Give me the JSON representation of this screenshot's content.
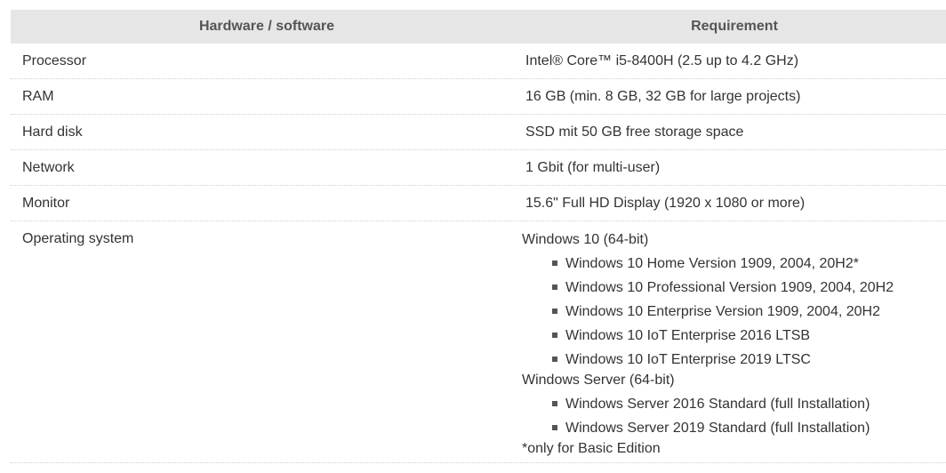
{
  "table": {
    "headers": {
      "hardware_software": "Hardware / software",
      "requirement": "Requirement"
    },
    "rows": [
      {
        "label": "Processor",
        "value": "Intel® Core™ i5-8400H (2.5 up to 4.2 GHz)"
      },
      {
        "label": "RAM",
        "value": "16 GB (min. 8 GB, 32 GB for large projects)"
      },
      {
        "label": "Hard disk",
        "value": "SSD mit 50 GB free storage space"
      },
      {
        "label": "Network",
        "value": "1 Gbit (for multi-user)"
      },
      {
        "label": "Monitor",
        "value": "15.6\" Full HD Display (1920 x 1080 or more)"
      }
    ],
    "os": {
      "label": "Operating system",
      "windows10": {
        "title": "Windows 10 (64-bit)",
        "items": [
          "Windows 10 Home Version 1909, 2004, 20H2*",
          "Windows 10 Professional Version 1909, 2004, 20H2",
          "Windows 10 Enterprise Version 1909, 2004, 20H2",
          "Windows 10 IoT Enterprise 2016 LTSB",
          "Windows 10 IoT Enterprise 2019 LTSC"
        ]
      },
      "server": {
        "title": "Windows Server (64-bit)",
        "items": [
          "Windows Server 2016 Standard (full Installation)",
          "Windows Server 2019 Standard (full Installation)"
        ]
      },
      "footnote": "*only for Basic Edition"
    }
  }
}
